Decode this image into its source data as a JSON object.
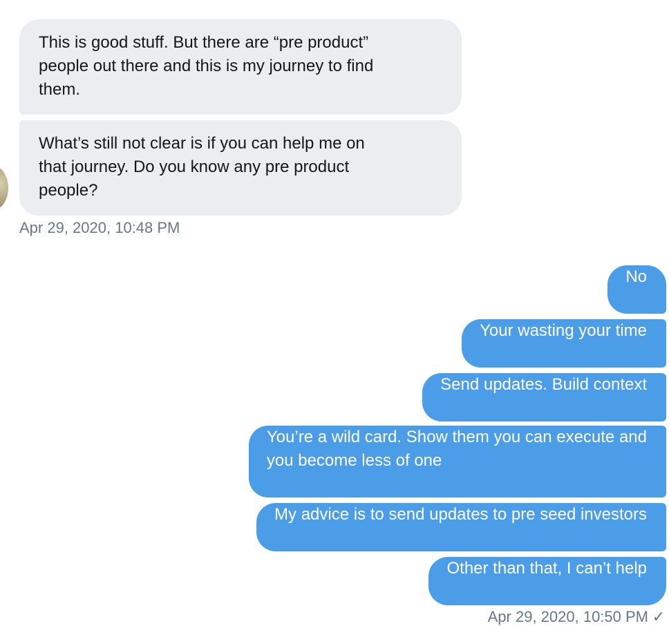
{
  "conversation": {
    "incoming": {
      "messages": [
        {
          "lines": [
            "This is good stuff. But there are “pre product”",
            "people out there and this is my journey to find",
            "them."
          ]
        },
        {
          "lines": [
            "What’s still not clear is if you can help me on",
            "that journey. Do you know any pre product",
            "people?"
          ]
        }
      ],
      "timestamp": "Apr 29, 2020, 10:48 PM"
    },
    "outgoing": {
      "messages": [
        {
          "lines": [
            "No"
          ]
        },
        {
          "lines": [
            "Your wasting your time"
          ]
        },
        {
          "lines": [
            "Send updates. Build context"
          ]
        },
        {
          "lines": [
            "You’re a wild card. Show them you can execute and",
            "you become less of one"
          ]
        },
        {
          "lines": [
            "My advice is to send updates to pre seed investors"
          ]
        },
        {
          "lines": [
            "Other than that, I can’t help"
          ]
        }
      ],
      "timestamp": "Apr 29, 2020, 10:50 PM",
      "status_icon": "check-icon"
    }
  },
  "colors": {
    "incoming_bubble": "#ebedf0",
    "outgoing_bubble": "#4c9de8",
    "timestamp_text": "#667785"
  }
}
